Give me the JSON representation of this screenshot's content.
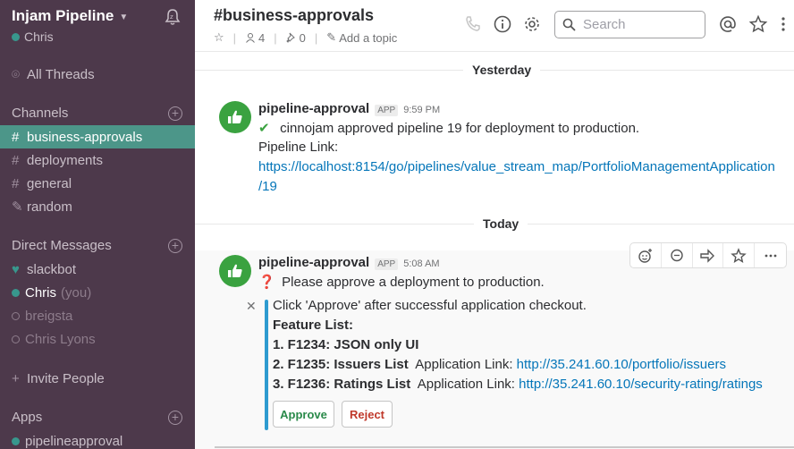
{
  "sidebar": {
    "team_name": "Injam Pipeline",
    "user_name": "Chris",
    "all_threads": "All Threads",
    "channels_header": "Channels",
    "channels": [
      {
        "label": "business-approvals",
        "active": true
      },
      {
        "label": "deployments"
      },
      {
        "label": "general"
      },
      {
        "label": "random"
      }
    ],
    "dm_header": "Direct Messages",
    "dms": [
      {
        "label": "slackbot"
      },
      {
        "label": "Chris",
        "suffix": "(you)"
      },
      {
        "label": "breigsta"
      },
      {
        "label": "Chris Lyons"
      }
    ],
    "invite": "Invite People",
    "apps_header": "Apps",
    "apps": [
      {
        "label": "pipelineapproval"
      }
    ]
  },
  "header": {
    "channel_title": "#business-approvals",
    "members_count": "4",
    "pins_count": "0",
    "add_topic": "Add a topic",
    "search_placeholder": "Search"
  },
  "messages": {
    "day1": "Yesterday",
    "day2": "Today",
    "msg1": {
      "author": "pipeline-approval",
      "badge": "APP",
      "time": "9:59 PM",
      "line1": "cinnojam approved pipeline 19 for deployment to production.",
      "line2": "Pipeline Link:",
      "link_a": "https://localhost:8154/go/pipelines/value_stream_map/PortfolioManagementApplication",
      "link_b": "/19"
    },
    "msg2": {
      "author": "pipeline-approval",
      "badge": "APP",
      "time": "5:08 AM",
      "line1": "Please approve a deployment to production.",
      "att_line1": "Click 'Approve' after successful application checkout.",
      "att_line2": "Feature List:",
      "f1": "1. F1234: JSON only UI",
      "f2_bold": "2. F1235: Issuers List",
      "f2_label": "Application Link:",
      "f2_link": "http://35.241.60.10/portfolio/issuers",
      "f3_bold": "3. F1236: Ratings List",
      "f3_label": "Application Link:",
      "f3_link": "http://35.241.60.10/security-rating/ratings",
      "approve": "Approve",
      "reject": "Reject"
    }
  },
  "colors": {
    "sidebar_bg": "#4d394b",
    "active_channel": "#4c9689",
    "link": "#0576b9",
    "approve": "#2a8a4a",
    "reject": "#c0392b",
    "attachment_bar": "#2e9bd0"
  }
}
